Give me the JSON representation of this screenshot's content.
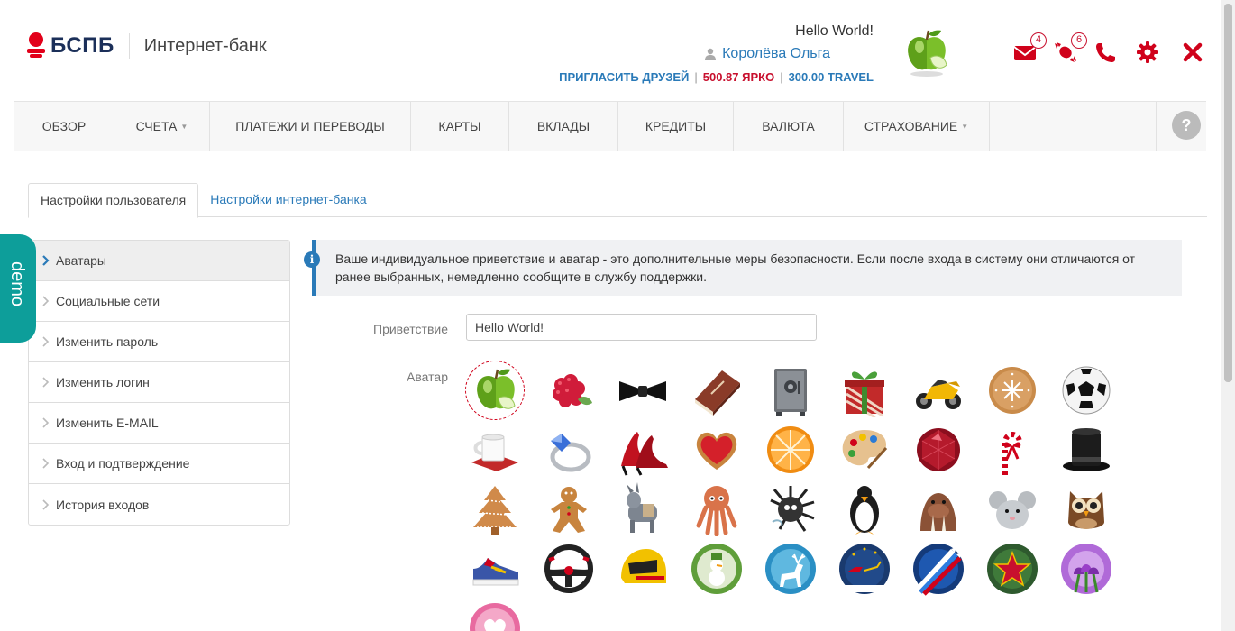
{
  "brand": {
    "logo_text": "БСПБ",
    "product": "Интернет-банк"
  },
  "user": {
    "greeting": "Hello World!",
    "name": "Королёва Ольга",
    "invite": "ПРИГЛАСИТЬ ДРУЗЕЙ",
    "bonus_yarko": "500.87 ЯРКО",
    "bonus_travel": "300.00 TRAVEL"
  },
  "header_icons": {
    "messages_count": "4",
    "offers_count": "6",
    "accent_color": "#d0021b"
  },
  "nav": {
    "items": [
      {
        "label": "Обзор",
        "dropdown": false
      },
      {
        "label": "Счета",
        "dropdown": true
      },
      {
        "label": "Платежи и переводы",
        "dropdown": false
      },
      {
        "label": "Карты",
        "dropdown": false
      },
      {
        "label": "Вклады",
        "dropdown": false
      },
      {
        "label": "Кредиты",
        "dropdown": false
      },
      {
        "label": "Валюта",
        "dropdown": false
      },
      {
        "label": "Страхование",
        "dropdown": true
      }
    ],
    "help_label": "?"
  },
  "tabs": [
    {
      "label": "Настройки пользователя",
      "active": true
    },
    {
      "label": "Настройки интернет-банка",
      "active": false
    }
  ],
  "demo_label": "demo",
  "side_menu": [
    {
      "label": "Аватары",
      "active": true
    },
    {
      "label": "Социальные сети",
      "active": false
    },
    {
      "label": "Изменить пароль",
      "active": false
    },
    {
      "label": "Изменить логин",
      "active": false
    },
    {
      "label": "Изменить E-MAIL",
      "active": false
    },
    {
      "label": "Вход и подтверждение",
      "active": false
    },
    {
      "label": "История входов",
      "active": false
    }
  ],
  "info": {
    "icon": "info-icon",
    "text": "Ваше индивидуальное приветствие и аватар - это дополнительные меры безопасности. Если после входа в систему они отличаются от ранее выбранных, немедленно сообщите в службу поддержки."
  },
  "form": {
    "greeting_label": "Приветствие",
    "greeting_value": "Hello World!",
    "avatar_label": "Аватар"
  },
  "avatars": [
    "apple",
    "raspberry",
    "bow-tie",
    "book",
    "safe",
    "gift",
    "motorcycle",
    "cookie",
    "soccer-ball",
    "cup",
    "ring",
    "high-heels",
    "gingerbread-heart",
    "orange",
    "palette",
    "ruby",
    "candy-cane",
    "top-hat",
    "gingerbread-tree",
    "gingerbread-man",
    "donkey",
    "octopus",
    "hedgehog",
    "penguin",
    "walrus",
    "mouse",
    "owl",
    "sneaker",
    "steering-wheel",
    "helmet",
    "snowman",
    "deer",
    "sleigh",
    "jets",
    "star-medal",
    "tulips",
    "pink-heart"
  ],
  "selected_avatar": "apple"
}
